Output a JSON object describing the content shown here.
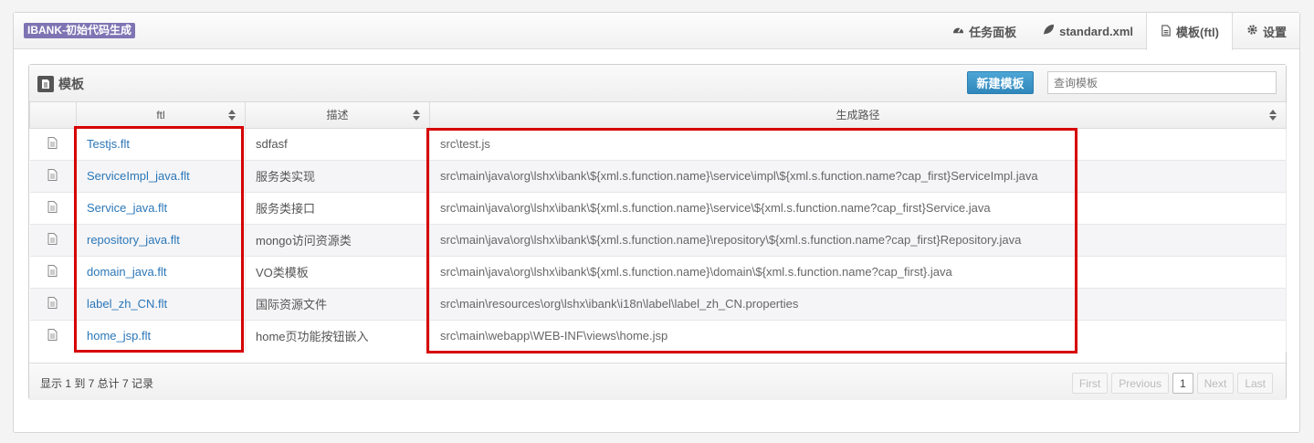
{
  "brand": "IBANK-初始代码生成",
  "tabs": [
    {
      "label": "任务面板",
      "icon": "dashboard-icon"
    },
    {
      "label": "standard.xml",
      "icon": "leaf-icon"
    },
    {
      "label": "模板(ftl)",
      "icon": "file-icon"
    },
    {
      "label": "设置",
      "icon": "gear-icon"
    }
  ],
  "panel": {
    "title": "模板",
    "new_button": "新建模板",
    "search_placeholder": "查询模板"
  },
  "table": {
    "columns": [
      "ftl",
      "描述",
      "生成路径"
    ],
    "rows": [
      {
        "ftl": "Testjs.flt",
        "desc": "sdfasf",
        "path": "src\\test.js"
      },
      {
        "ftl": "ServiceImpl_java.flt",
        "desc": "服务类实现",
        "path": "src\\main\\java\\org\\lshx\\ibank\\${xml.s.function.name}\\service\\impl\\${xml.s.function.name?cap_first}ServiceImpl.java"
      },
      {
        "ftl": "Service_java.flt",
        "desc": "服务类接口",
        "path": "src\\main\\java\\org\\lshx\\ibank\\${xml.s.function.name}\\service\\${xml.s.function.name?cap_first}Service.java"
      },
      {
        "ftl": "repository_java.flt",
        "desc": "mongo访问资源类",
        "path": "src\\main\\java\\org\\lshx\\ibank\\${xml.s.function.name}\\repository\\${xml.s.function.name?cap_first}Repository.java"
      },
      {
        "ftl": "domain_java.flt",
        "desc": "VO类模板",
        "path": "src\\main\\java\\org\\lshx\\ibank\\${xml.s.function.name}\\domain\\${xml.s.function.name?cap_first}.java"
      },
      {
        "ftl": "label_zh_CN.flt",
        "desc": "国际资源文件",
        "path": "src\\main\\resources\\org\\lshx\\ibank\\i18n\\label\\label_zh_CN.properties"
      },
      {
        "ftl": "home_jsp.flt",
        "desc": "home页功能按钮嵌入",
        "path": "src\\main\\webapp\\WEB-INF\\views\\home.jsp"
      }
    ]
  },
  "footer": {
    "info": "显示 1 到 7 总计 7 记录",
    "pager": [
      "First",
      "Previous",
      "1",
      "Next",
      "Last"
    ],
    "current_page": "1"
  },
  "colors": {
    "brand_bg": "#7f74b3",
    "button": "#3a94c8",
    "link": "#2b77b8",
    "highlight": "#d60000"
  }
}
